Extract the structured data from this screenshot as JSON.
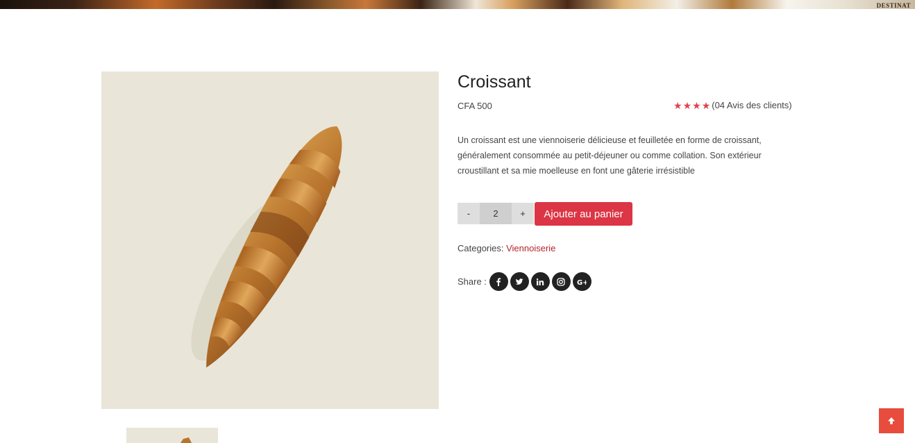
{
  "hero": {
    "text": "DESTINAT"
  },
  "product": {
    "title": "Croissant",
    "price": "CFA 500",
    "rating": 4,
    "reviews": "(04 Avis des clients)",
    "description": "Un croissant est une viennoiserie délicieuse et feuilletée en forme de croissant, généralement consommée au petit-déjeuner ou comme collation. Son extérieur croustillant et sa mie moelleuse en font une gâterie irrésistible",
    "quantity": "2"
  },
  "cart": {
    "minus_label": "-",
    "plus_label": "+",
    "add_label": "Ajouter au panier"
  },
  "categories": {
    "label": "Categories:",
    "value": "Viennoiserie"
  },
  "share": {
    "label": "Share :",
    "networks": [
      "facebook-icon",
      "twitter-icon",
      "linkedin-icon",
      "instagram-icon",
      "google-plus-icon"
    ]
  },
  "colors": {
    "accent": "#dc3545",
    "star": "#e0434a",
    "category_link": "#b3242f",
    "back_to_top": "#e74c3c"
  }
}
